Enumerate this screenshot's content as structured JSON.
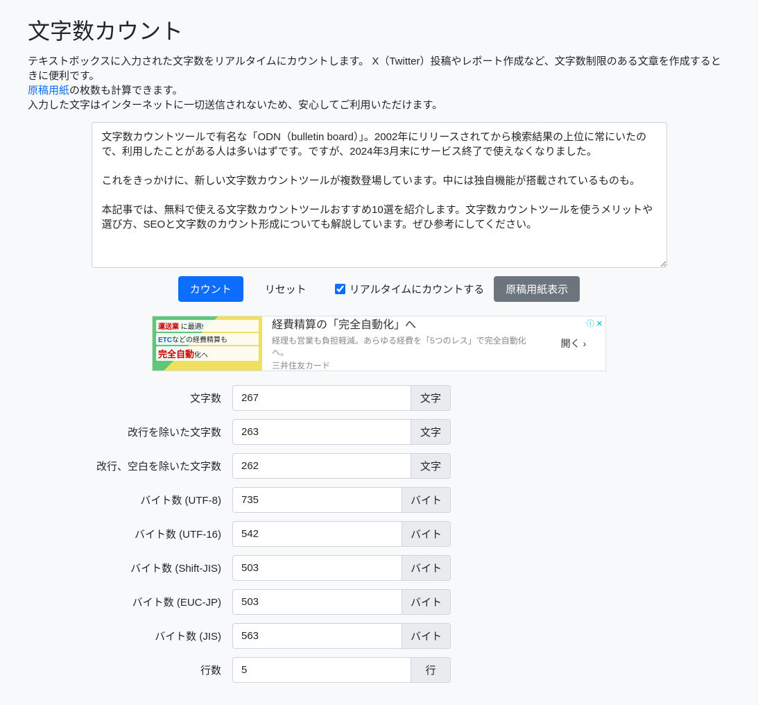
{
  "title": "文字数カウント",
  "description": {
    "line1": "テキストボックスに入力された文字数をリアルタイムにカウントします。 X（Twitter）投稿やレポート作成など、文字数制限のある文章を作成するときに便利です。",
    "link_text": "原稿用紙",
    "line2_after_link": "の枚数も計算できます。",
    "line3": "入力した文字はインターネットに一切送信されないため、安心してご利用いただけます。"
  },
  "textarea_value": "文字数カウントツールで有名な「ODN（bulletin board）」。2002年にリリースされてから検索結果の上位に常にいたので、利用したことがある人は多いはずです。ですが、2024年3月末にサービス終了で使えなくなりました。\n\nこれをきっかけに、新しい文字数カウントツールが複数登場しています。中には独自機能が搭載されているものも。\n\n本記事では、無料で使える文字数カウントツールおすすめ10選を紹介します。文字数カウントツールを使うメリットや選び方、SEOと文字数のカウント形成についても解説しています。ぜひ参考にしてください。",
  "controls": {
    "count_button": "カウント",
    "reset_button": "リセット",
    "realtime_checkbox_label": "リアルタイムにカウントする",
    "realtime_checked": true,
    "manuscript_button": "原稿用紙表示"
  },
  "ad": {
    "banner_line1_hl": "運送業",
    "banner_line1_rest": " に最適!",
    "banner_line2_etc": "ETC",
    "banner_line2_rest": "などの経費精算も",
    "banner_auto_pre": "完全自動",
    "banner_auto_post": "化へ",
    "title": "経費精算の「完全自動化」へ",
    "subtitle": "経理も営業も負担軽減。あらゆる経費を「5つのレス」で完全自動化へ。",
    "company": "三井住友カード",
    "open": "開く",
    "info_icon": "ⓘ",
    "close_icon": "✕"
  },
  "results": [
    {
      "label": "文字数",
      "value": "267",
      "unit": "文字"
    },
    {
      "label": "改行を除いた文字数",
      "value": "263",
      "unit": "文字"
    },
    {
      "label": "改行、空白を除いた文字数",
      "value": "262",
      "unit": "文字"
    },
    {
      "label": "バイト数 (UTF-8)",
      "value": "735",
      "unit": "バイト"
    },
    {
      "label": "バイト数 (UTF-16)",
      "value": "542",
      "unit": "バイト"
    },
    {
      "label": "バイト数 (Shift-JIS)",
      "value": "503",
      "unit": "バイト"
    },
    {
      "label": "バイト数 (EUC-JP)",
      "value": "503",
      "unit": "バイト"
    },
    {
      "label": "バイト数 (JIS)",
      "value": "563",
      "unit": "バイト"
    },
    {
      "label": "行数",
      "value": "5",
      "unit": "行"
    }
  ]
}
